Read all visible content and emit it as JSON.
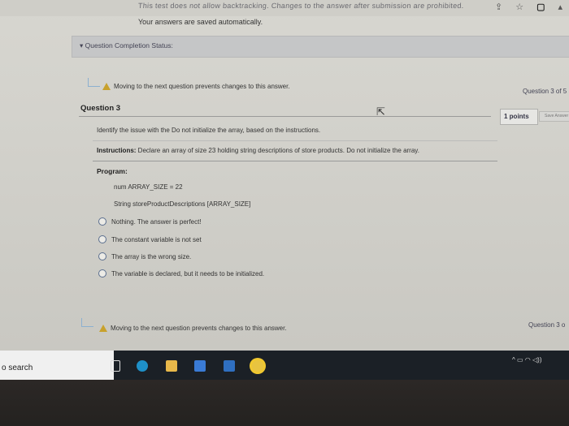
{
  "header": {
    "blurred_notice": "This test does not allow backtracking. Changes to the answer after submission are prohibited.",
    "saved_message": "Your answers are saved automatically."
  },
  "browser_icons": [
    "share-icon",
    "star-icon",
    "window-icon",
    "menu-icon"
  ],
  "status_bar": {
    "label": "Question Completion Status:"
  },
  "warning_top": {
    "text": "Moving to the next question prevents changes to this answer."
  },
  "progress_top": "Question 3 of 5",
  "question": {
    "title": "Question 3",
    "points": "1 points",
    "save_label": "Save Answer",
    "prompt": "Identify the issue with the Do not initialize the array, based on the instructions.",
    "instructions_label": "Instructions:",
    "instructions_text": " Declare an array of size 23 holding string descriptions of store products. Do not initialize the array.",
    "program_label": "Program:",
    "code": [
      "num ARRAY_SIZE = 22",
      "String storeProductDescriptions [ARRAY_SIZE]"
    ],
    "choices": [
      "Nothing. The answer is perfect!",
      "The constant variable is not set",
      "The array is the wrong size.",
      "The variable is declared, but it needs to be initialized."
    ]
  },
  "warning_bottom": {
    "text": "Moving to the next question prevents changes to this answer."
  },
  "progress_bottom": "Question 3 o",
  "taskbar": {
    "search": "o search",
    "apps": [
      "task-view-icon",
      "edge-icon",
      "file-explorer-icon",
      "store-icon",
      "mail-icon",
      "chrome-icon"
    ]
  },
  "colors": {
    "warning": "#c8a12c",
    "taskbar": "#1b2026",
    "accent_link": "#8cb0d0"
  }
}
